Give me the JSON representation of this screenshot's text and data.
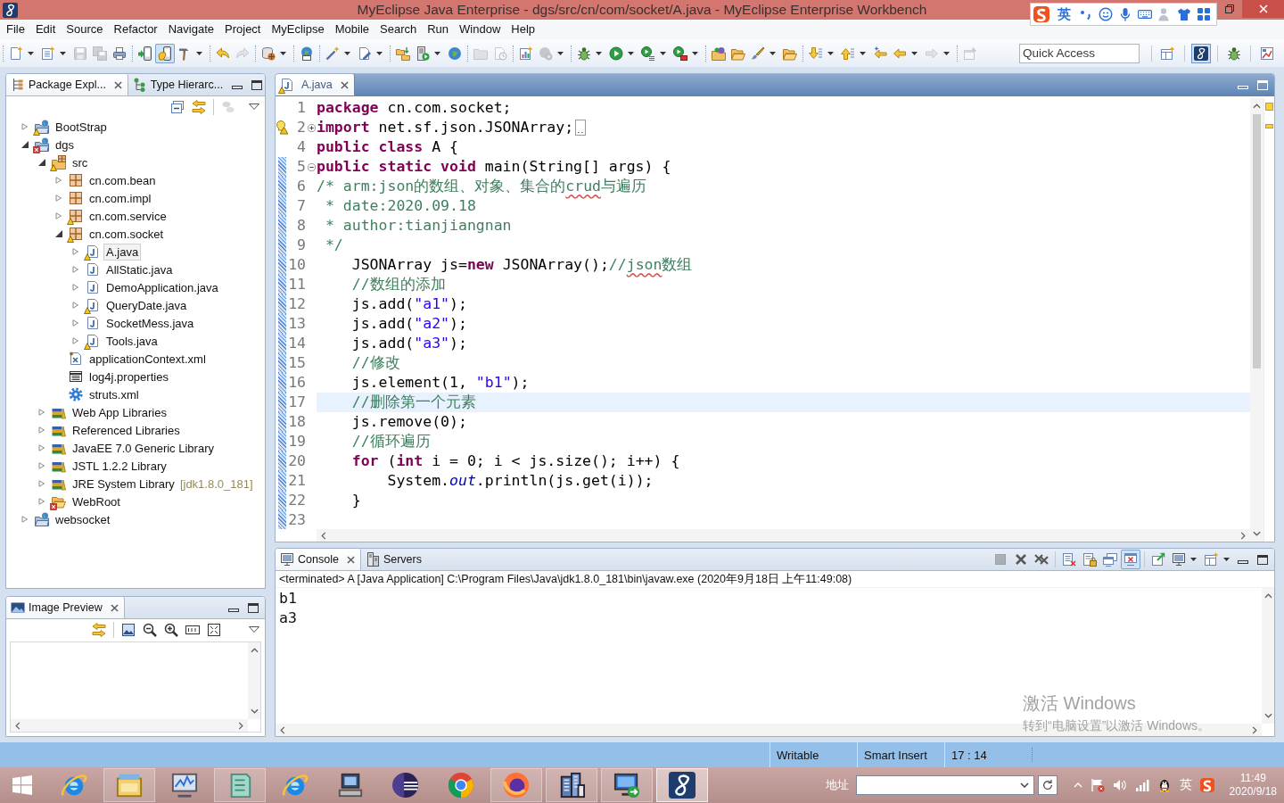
{
  "window": {
    "title": "MyEclipse Java Enterprise - dgs/src/cn/com/socket/A.java - MyEclipse Enterprise Workbench"
  },
  "ime_bar": {
    "language": "英"
  },
  "menu": [
    "File",
    "Edit",
    "Source",
    "Refactor",
    "Navigate",
    "Project",
    "MyEclipse",
    "Mobile",
    "Search",
    "Run",
    "Window",
    "Help"
  ],
  "toolbar": {
    "groups": [
      [
        {
          "kind": "new",
          "dropdown": true,
          "disabled": false,
          "pressed": false
        },
        {
          "kind": "newtype",
          "dropdown": true,
          "disabled": false,
          "pressed": false
        },
        {
          "kind": "save",
          "dropdown": false,
          "disabled": true,
          "pressed": false
        },
        {
          "kind": "saveall",
          "dropdown": false,
          "disabled": true,
          "pressed": false
        },
        {
          "kind": "print",
          "dropdown": false,
          "disabled": false,
          "pressed": false
        }
      ],
      [
        {
          "kind": "device",
          "dropdown": false,
          "disabled": false,
          "pressed": false
        },
        {
          "kind": "devicehand",
          "dropdown": false,
          "disabled": false,
          "pressed": true
        },
        {
          "kind": "build",
          "dropdown": true,
          "disabled": false,
          "pressed": false
        }
      ],
      [
        {
          "kind": "undo",
          "dropdown": false,
          "disabled": false,
          "pressed": false
        },
        {
          "kind": "redo",
          "dropdown": false,
          "disabled": true,
          "pressed": false
        }
      ],
      [
        {
          "kind": "db",
          "dropdown": true,
          "disabled": false,
          "pressed": false
        }
      ],
      [
        {
          "kind": "web20",
          "dropdown": false,
          "disabled": false,
          "pressed": false
        }
      ],
      [
        {
          "kind": "wand",
          "dropdown": true,
          "disabled": false,
          "pressed": false
        },
        {
          "kind": "pendoc",
          "dropdown": true,
          "disabled": false,
          "pressed": false
        }
      ],
      [
        {
          "kind": "swap",
          "dropdown": false,
          "disabled": false,
          "pressed": false
        },
        {
          "kind": "serverrun",
          "dropdown": true,
          "disabled": false,
          "pressed": false
        },
        {
          "kind": "globe",
          "dropdown": false,
          "disabled": false,
          "pressed": false
        }
      ],
      [
        {
          "kind": "folder",
          "dropdown": false,
          "disabled": true,
          "pressed": false
        },
        {
          "kind": "clockdoc",
          "dropdown": false,
          "disabled": true,
          "pressed": false
        }
      ],
      [
        {
          "kind": "chartdoc",
          "dropdown": false,
          "disabled": false,
          "pressed": false
        },
        {
          "kind": "gearglobe",
          "dropdown": true,
          "disabled": true,
          "pressed": false
        }
      ],
      [
        {
          "kind": "debug",
          "dropdown": true,
          "disabled": false,
          "pressed": false
        },
        {
          "kind": "run",
          "dropdown": true,
          "disabled": false,
          "pressed": false
        },
        {
          "kind": "runlist",
          "dropdown": true,
          "disabled": false,
          "pressed": false
        },
        {
          "kind": "runext",
          "dropdown": true,
          "disabled": false,
          "pressed": false
        }
      ],
      [
        {
          "kind": "opentype",
          "dropdown": false,
          "disabled": false,
          "pressed": false
        },
        {
          "kind": "openfolder",
          "dropdown": false,
          "disabled": false,
          "pressed": false
        },
        {
          "kind": "brush",
          "dropdown": true,
          "disabled": false,
          "pressed": false
        },
        {
          "kind": "openfolder",
          "dropdown": false,
          "disabled": false,
          "pressed": false
        }
      ],
      [
        {
          "kind": "nextann",
          "dropdown": true,
          "disabled": false,
          "pressed": false
        },
        {
          "kind": "prevann",
          "dropdown": true,
          "disabled": false,
          "pressed": false
        },
        {
          "kind": "lastedit",
          "dropdown": false,
          "disabled": false,
          "pressed": false
        },
        {
          "kind": "back",
          "dropdown": true,
          "disabled": false,
          "pressed": false
        },
        {
          "kind": "forward",
          "dropdown": true,
          "disabled": true,
          "pressed": false
        }
      ],
      [
        {
          "kind": "pin",
          "dropdown": false,
          "disabled": true,
          "pressed": false
        }
      ]
    ],
    "quick_access": {
      "placeholder": "Quick Access"
    },
    "perspectives": [
      {
        "kind": "open",
        "selected": false
      },
      {
        "kind": "myeclipse",
        "selected": true
      },
      {
        "kind": "debug",
        "selected": false
      },
      {
        "kind": "image",
        "selected": false
      }
    ]
  },
  "package_explorer": {
    "tabs": [
      {
        "label": "Package Expl...",
        "kind": "packages",
        "selected": true
      },
      {
        "label": "Type Hierarc...",
        "kind": "hierarchy",
        "selected": false
      }
    ],
    "toolbar": [
      [
        {
          "kind": "collapse",
          "dropdown": false,
          "disabled": false,
          "pressed": false
        },
        {
          "kind": "link",
          "dropdown": false,
          "disabled": false,
          "pressed": false
        }
      ],
      [
        {
          "kind": "filter",
          "dropdown": false,
          "disabled": true,
          "pressed": false
        }
      ]
    ],
    "tree": [
      {
        "label": "BootStrap",
        "kind": "project",
        "warning": true,
        "error": false,
        "expanded": false,
        "selected": false
      },
      {
        "label": "dgs",
        "kind": "project",
        "warning": false,
        "error": true,
        "expanded": true,
        "selected": false,
        "children": [
          {
            "label": "src",
            "kind": "source",
            "warning": true,
            "error": false,
            "expanded": true,
            "selected": false,
            "children": [
              {
                "label": "cn.com.bean",
                "kind": "package",
                "warning": false,
                "error": false,
                "expanded": false,
                "selected": false
              },
              {
                "label": "cn.com.impl",
                "kind": "package",
                "warning": false,
                "error": false,
                "expanded": false,
                "selected": false
              },
              {
                "label": "cn.com.service",
                "kind": "package",
                "warning": true,
                "error": false,
                "expanded": false,
                "selected": false
              },
              {
                "label": "cn.com.socket",
                "kind": "package",
                "warning": true,
                "error": false,
                "expanded": true,
                "selected": false,
                "children": [
                  {
                    "label": "A.java",
                    "kind": "java",
                    "warning": true,
                    "error": false,
                    "expanded": false,
                    "selected": true
                  },
                  {
                    "label": "AllStatic.java",
                    "kind": "java",
                    "warning": false,
                    "error": false,
                    "expanded": false,
                    "selected": false
                  },
                  {
                    "label": "DemoApplication.java",
                    "kind": "java",
                    "warning": false,
                    "error": false,
                    "expanded": false,
                    "selected": false
                  },
                  {
                    "label": "QueryDate.java",
                    "kind": "java",
                    "warning": true,
                    "error": false,
                    "expanded": false,
                    "selected": false
                  },
                  {
                    "label": "SocketMess.java",
                    "kind": "java",
                    "warning": false,
                    "error": false,
                    "expanded": false,
                    "selected": false
                  },
                  {
                    "label": "Tools.java",
                    "kind": "java",
                    "warning": true,
                    "error": false,
                    "expanded": false,
                    "selected": false
                  }
                ]
              },
              {
                "label": "applicationContext.xml",
                "kind": "xml",
                "warning": false,
                "error": false,
                "selected": false
              },
              {
                "label": "log4j.properties",
                "kind": "properties",
                "warning": false,
                "error": false,
                "selected": false
              },
              {
                "label": "struts.xml",
                "kind": "config",
                "warning": false,
                "error": false,
                "selected": false
              }
            ]
          },
          {
            "label": "Web App Libraries",
            "kind": "library",
            "warning": false,
            "error": false,
            "expanded": false,
            "selected": false
          },
          {
            "label": "Referenced Libraries",
            "kind": "library",
            "warning": false,
            "error": false,
            "expanded": false,
            "selected": false
          },
          {
            "label": "JavaEE 7.0 Generic Library",
            "kind": "library",
            "warning": false,
            "error": false,
            "expanded": false,
            "selected": false
          },
          {
            "label": "JSTL 1.2.2 Library",
            "kind": "library",
            "warning": false,
            "error": false,
            "expanded": false,
            "selected": false
          },
          {
            "label": "JRE System Library",
            "decoration": "[jdk1.8.0_181]",
            "kind": "library",
            "warning": false,
            "error": false,
            "expanded": false,
            "selected": false
          },
          {
            "label": "WebRoot",
            "kind": "folder",
            "warning": false,
            "error": true,
            "expanded": false,
            "selected": false
          }
        ]
      },
      {
        "label": "websocket",
        "kind": "project",
        "warning": false,
        "error": false,
        "expanded": false,
        "selected": false
      }
    ]
  },
  "image_preview": {
    "tabs": [
      {
        "label": "Image Preview",
        "kind": "image",
        "selected": true
      }
    ],
    "toolbar": [
      [
        {
          "kind": "link",
          "dropdown": false,
          "disabled": false,
          "pressed": false
        }
      ],
      [
        {
          "kind": "fitimage",
          "dropdown": false,
          "disabled": false,
          "pressed": false
        },
        {
          "kind": "zoomout",
          "dropdown": false,
          "disabled": false,
          "pressed": false
        },
        {
          "kind": "zoomin",
          "dropdown": false,
          "disabled": false,
          "pressed": false
        },
        {
          "kind": "actualsize",
          "dropdown": false,
          "disabled": false,
          "pressed": false
        },
        {
          "kind": "fitwindow",
          "dropdown": false,
          "disabled": false,
          "pressed": false
        }
      ]
    ]
  },
  "editor": {
    "tabs": [
      {
        "label": "A.java",
        "kind": "java",
        "warning": true,
        "selected": true
      }
    ],
    "lines": [
      {
        "number": "1",
        "changed": false,
        "current": false,
        "warning": false,
        "tokens": [
          {
            "kind": "keyword",
            "text": "package"
          },
          {
            "kind": "plain",
            "text": " cn.com.socket;"
          }
        ]
      },
      {
        "number": "2",
        "changed": false,
        "current": false,
        "warning": true,
        "folded": true,
        "tokens": [
          {
            "kind": "keyword",
            "text": "import"
          },
          {
            "kind": "plain",
            "text": " net.sf.json.JSONArray;"
          }
        ]
      },
      {
        "number": "4",
        "changed": false,
        "current": false,
        "warning": false,
        "tokens": [
          {
            "kind": "keyword",
            "text": "public class"
          },
          {
            "kind": "plain",
            "text": " A {"
          }
        ]
      },
      {
        "number": "5",
        "changed": true,
        "current": false,
        "warning": false,
        "folded": false,
        "tokens": [
          {
            "kind": "keyword",
            "text": "public static void"
          },
          {
            "kind": "plain",
            "text": " main(String[] args) {"
          }
        ]
      },
      {
        "number": "6",
        "changed": true,
        "current": false,
        "warning": false,
        "tokens": [
          {
            "kind": "comment",
            "text": "/* arm:json的数组、对象、集合的"
          },
          {
            "kind": "spelling",
            "text": "crud"
          },
          {
            "kind": "comment",
            "text": "与遍历"
          }
        ]
      },
      {
        "number": "7",
        "changed": true,
        "current": false,
        "warning": false,
        "tokens": [
          {
            "kind": "comment",
            "text": " * date:2020.09.18"
          }
        ]
      },
      {
        "number": "8",
        "changed": true,
        "current": false,
        "warning": false,
        "tokens": [
          {
            "kind": "comment",
            "text": " * author:tianjiangnan"
          }
        ]
      },
      {
        "number": "9",
        "changed": true,
        "current": false,
        "warning": false,
        "tokens": [
          {
            "kind": "comment",
            "text": " */"
          }
        ]
      },
      {
        "number": "10",
        "changed": true,
        "current": false,
        "warning": false,
        "tokens": [
          {
            "kind": "plain",
            "text": "    JSONArray js="
          },
          {
            "kind": "keyword",
            "text": "new"
          },
          {
            "kind": "plain",
            "text": " JSONArray();"
          },
          {
            "kind": "comment",
            "text": "//"
          },
          {
            "kind": "spelling",
            "text": "json"
          },
          {
            "kind": "comment",
            "text": "数组"
          }
        ]
      },
      {
        "number": "11",
        "changed": true,
        "current": false,
        "warning": false,
        "tokens": [
          {
            "kind": "comment",
            "text": "    //数组的添加"
          }
        ]
      },
      {
        "number": "12",
        "changed": true,
        "current": false,
        "warning": false,
        "tokens": [
          {
            "kind": "plain",
            "text": "    js.add("
          },
          {
            "kind": "string",
            "text": "\"a1\""
          },
          {
            "kind": "plain",
            "text": ");"
          }
        ]
      },
      {
        "number": "13",
        "changed": true,
        "current": false,
        "warning": false,
        "tokens": [
          {
            "kind": "plain",
            "text": "    js.add("
          },
          {
            "kind": "string",
            "text": "\"a2\""
          },
          {
            "kind": "plain",
            "text": ");"
          }
        ]
      },
      {
        "number": "14",
        "changed": true,
        "current": false,
        "warning": false,
        "tokens": [
          {
            "kind": "plain",
            "text": "    js.add("
          },
          {
            "kind": "string",
            "text": "\"a3\""
          },
          {
            "kind": "plain",
            "text": ");"
          }
        ]
      },
      {
        "number": "15",
        "changed": true,
        "current": false,
        "warning": false,
        "tokens": [
          {
            "kind": "comment",
            "text": "    //修改"
          }
        ]
      },
      {
        "number": "16",
        "changed": true,
        "current": false,
        "warning": false,
        "tokens": [
          {
            "kind": "plain",
            "text": "    js.element(1, "
          },
          {
            "kind": "string",
            "text": "\"b1\""
          },
          {
            "kind": "plain",
            "text": ");"
          }
        ]
      },
      {
        "number": "17",
        "changed": true,
        "current": true,
        "warning": false,
        "tokens": [
          {
            "kind": "comment",
            "text": "    //删除第一个元素"
          }
        ]
      },
      {
        "number": "18",
        "changed": true,
        "current": false,
        "warning": false,
        "tokens": [
          {
            "kind": "plain",
            "text": "    js.remove(0);"
          }
        ]
      },
      {
        "number": "19",
        "changed": true,
        "current": false,
        "warning": false,
        "tokens": [
          {
            "kind": "comment",
            "text": "    //循环遍历"
          }
        ]
      },
      {
        "number": "20",
        "changed": true,
        "current": false,
        "warning": false,
        "tokens": [
          {
            "kind": "keyword",
            "text": "    for"
          },
          {
            "kind": "plain",
            "text": " ("
          },
          {
            "kind": "keyword",
            "text": "int"
          },
          {
            "kind": "plain",
            "text": " i = 0; i < js.size(); i++) {"
          }
        ]
      },
      {
        "number": "21",
        "changed": true,
        "current": false,
        "warning": false,
        "tokens": [
          {
            "kind": "plain",
            "text": "        System."
          },
          {
            "kind": "field",
            "text": "out"
          },
          {
            "kind": "plain",
            "text": ".println(js.get(i));"
          }
        ]
      },
      {
        "number": "22",
        "changed": true,
        "current": false,
        "warning": false,
        "tokens": [
          {
            "kind": "plain",
            "text": "    }"
          }
        ]
      },
      {
        "number": "23",
        "changed": true,
        "current": false,
        "warning": false
      }
    ]
  },
  "console": {
    "tabs": [
      {
        "label": "Console",
        "kind": "console",
        "selected": true
      },
      {
        "label": "Servers",
        "kind": "servers",
        "selected": false
      }
    ],
    "toolbar": [
      [
        {
          "kind": "terminate",
          "dropdown": false,
          "disabled": true,
          "pressed": false
        },
        {
          "kind": "remove",
          "dropdown": false,
          "disabled": false,
          "pressed": false
        },
        {
          "kind": "removeall",
          "dropdown": false,
          "disabled": false,
          "pressed": false
        }
      ],
      [
        {
          "kind": "clear",
          "dropdown": false,
          "disabled": false,
          "pressed": false
        },
        {
          "kind": "scrolllock",
          "dropdown": false,
          "disabled": false,
          "pressed": false
        },
        {
          "kind": "stdout",
          "dropdown": false,
          "disabled": false,
          "pressed": false
        },
        {
          "kind": "stderr",
          "dropdown": false,
          "disabled": false,
          "pressed": true
        }
      ],
      [
        {
          "kind": "pinconsole",
          "dropdown": false,
          "disabled": false,
          "pressed": false
        },
        {
          "kind": "display",
          "dropdown": true,
          "disabled": false,
          "pressed": false
        },
        {
          "kind": "openconsole",
          "dropdown": true,
          "disabled": false,
          "pressed": false
        }
      ]
    ],
    "header": "<terminated> A [Java Application] C:\\Program Files\\Java\\jdk1.8.0_181\\bin\\javaw.exe (2020年9月18日 上午11:49:08)",
    "output": [
      "b1",
      "a3"
    ]
  },
  "activation_notice": {
    "title": "激活 Windows",
    "hint": "转到“电脑设置”以激活 Windows。"
  },
  "status_bar": {
    "fields": [
      "Writable",
      "Smart Insert",
      "17 : 14"
    ]
  },
  "taskbar": {
    "apps": [
      {
        "kind": "ie",
        "running": false,
        "selected": false
      },
      {
        "kind": "explorer",
        "running": true,
        "selected": false
      },
      {
        "kind": "monitor",
        "running": false,
        "selected": false
      },
      {
        "kind": "notepad",
        "running": true,
        "selected": false
      },
      {
        "kind": "ie",
        "running": false,
        "selected": false
      },
      {
        "kind": "computer",
        "running": false,
        "selected": false
      },
      {
        "kind": "eclipse",
        "running": false,
        "selected": false
      },
      {
        "kind": "chrome",
        "running": false,
        "selected": false
      },
      {
        "kind": "firefox",
        "running": true,
        "selected": false
      },
      {
        "kind": "buildings",
        "running": true,
        "selected": false
      },
      {
        "kind": "remote",
        "running": true,
        "selected": false
      },
      {
        "kind": "myeclipse",
        "running": true,
        "selected": true
      }
    ],
    "address": {
      "label": "地址"
    },
    "tray": {
      "language": "英",
      "time": "11:49",
      "date": "2020/9/18"
    }
  }
}
